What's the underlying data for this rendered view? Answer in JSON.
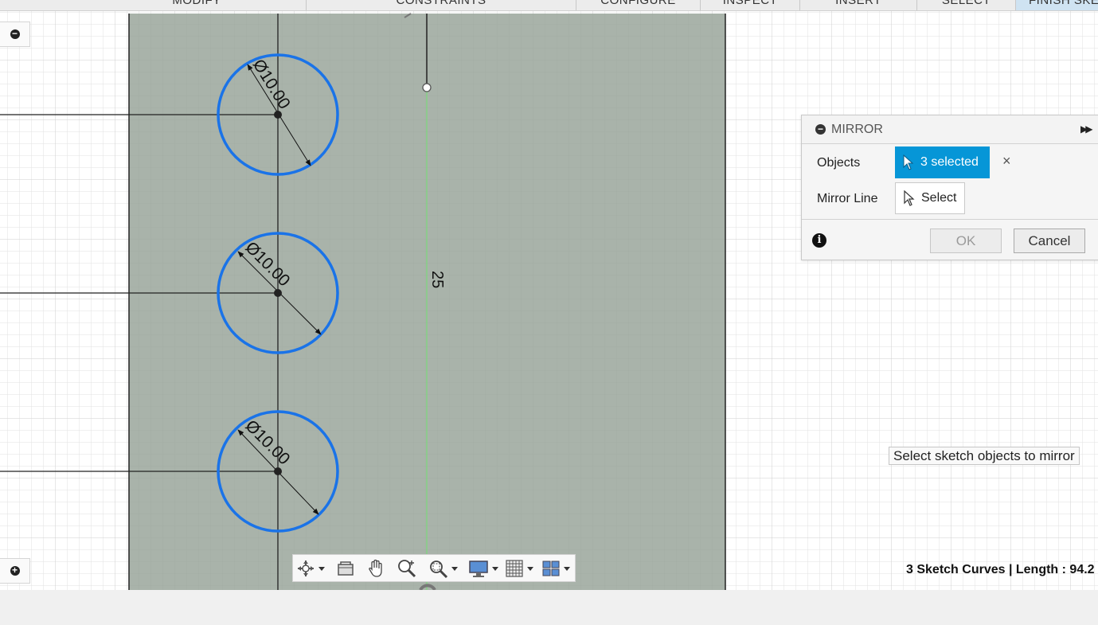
{
  "menubar": {
    "items": [
      "MODIFY",
      "CONSTRAINTS",
      "CONFIGURE",
      "INSPECT",
      "INSERT",
      "SELECT",
      "FINISH SKETCH"
    ]
  },
  "sketch": {
    "dimensions": [
      {
        "label": "Ø10.00"
      },
      {
        "label": "Ø10.00"
      },
      {
        "label": "Ø10.00"
      }
    ],
    "linear_dimension": "25"
  },
  "mirror_panel": {
    "title": "MIRROR",
    "objects_label": "Objects",
    "objects_value": "3 selected",
    "clear_symbol": "×",
    "mirror_line_label": "Mirror Line",
    "mirror_line_value": "Select",
    "ok_label": "OK",
    "cancel_label": "Cancel",
    "ok_enabled": false
  },
  "tooltip": "Select sketch objects to mirror",
  "status_bar": "3 Sketch Curves | Length : 94.2",
  "side_buttons": {
    "top_symbol": "−",
    "bottom_symbol": "+"
  },
  "colors": {
    "accent": "#0696d7",
    "selected_curve": "#1a73e8",
    "sketch_profile": "#a9b3aa",
    "mirror_line": "#7dd87d"
  },
  "navbar": {
    "icons": [
      "orbit-icon",
      "look-at-icon",
      "pan-icon",
      "zoom-icon",
      "fit-icon",
      "display-settings-icon",
      "grid-settings-icon",
      "viewports-icon"
    ]
  }
}
